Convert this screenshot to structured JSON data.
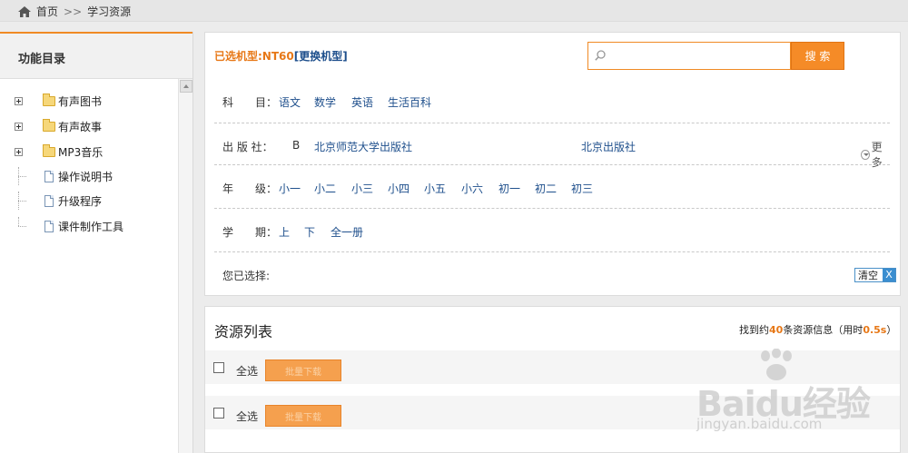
{
  "breadcrumb": {
    "home": "首页",
    "sep": ">>",
    "current": "学习资源"
  },
  "sidebar": {
    "title": "功能目录",
    "items": [
      {
        "label": "有声图书",
        "type": "folder"
      },
      {
        "label": "有声故事",
        "type": "folder"
      },
      {
        "label": "MP3音乐",
        "type": "folder"
      },
      {
        "label": "操作说明书",
        "type": "doc"
      },
      {
        "label": "升级程序",
        "type": "doc"
      },
      {
        "label": "课件制作工具",
        "type": "doc"
      }
    ]
  },
  "filter": {
    "model_prefix": "已选机型:NT60",
    "model_change": "[更换机型]",
    "search": {
      "placeholder": "",
      "button": "搜 索"
    },
    "subject": {
      "label": "科　　目：",
      "options": [
        "语文",
        "数学",
        "英语",
        "生活百科"
      ]
    },
    "publisher": {
      "label": "出 版 社：",
      "letter": "B",
      "options": [
        "北京师范大学出版社",
        "北京出版社"
      ],
      "more": "更多"
    },
    "grade": {
      "label": "年　　级：",
      "options": [
        "小一",
        "小二",
        "小三",
        "小四",
        "小五",
        "小六",
        "初一",
        "初二",
        "初三"
      ]
    },
    "term": {
      "label": "学　　期：",
      "options": [
        "上",
        "下",
        "全一册"
      ]
    },
    "selected": {
      "label": "您已选择:",
      "clear": "清空",
      "clear_x": "X"
    }
  },
  "resources": {
    "title": "资源列表",
    "stat_prefix": "找到约",
    "stat_count": "40",
    "stat_mid": "条资源信息（用时",
    "stat_time": "0.5s",
    "stat_suffix": "）",
    "rows": [
      {
        "select_all": "全选",
        "button": "批量下载"
      },
      {
        "select_all": "全选",
        "button": "批量下载"
      }
    ]
  },
  "watermark": {
    "brand": "Baidu经验",
    "url": "jingyan.baidu.com"
  },
  "colors": {
    "accent": "#f08a24",
    "link": "#1e4f8c"
  }
}
